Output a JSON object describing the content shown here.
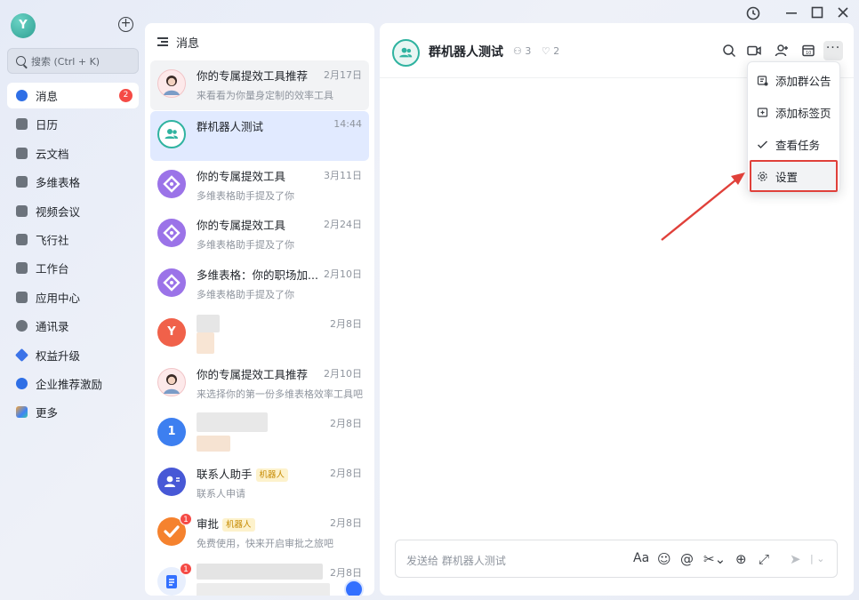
{
  "window": {
    "controls": [
      "history-icon",
      "minimize-icon",
      "maximize-icon",
      "close-icon"
    ]
  },
  "user": {
    "avatar_letter": "Y"
  },
  "search": {
    "placeholder": "搜索 (Ctrl + K)"
  },
  "nav": {
    "items": [
      {
        "label": "消息",
        "icon": "message-icon",
        "badge": "2",
        "active": true
      },
      {
        "label": "日历",
        "icon": "calendar-icon"
      },
      {
        "label": "云文档",
        "icon": "cloud-doc-icon"
      },
      {
        "label": "多维表格",
        "icon": "base-table-icon"
      },
      {
        "label": "视频会议",
        "icon": "video-meeting-icon"
      },
      {
        "label": "飞行社",
        "icon": "flight-club-icon"
      },
      {
        "label": "工作台",
        "icon": "workplace-icon"
      },
      {
        "label": "应用中心",
        "icon": "app-center-icon"
      },
      {
        "label": "通讯录",
        "icon": "contacts-icon"
      },
      {
        "label": "权益升级",
        "icon": "upgrade-diamond-icon"
      },
      {
        "label": "企业推荐激励",
        "icon": "referral-icon"
      },
      {
        "label": "更多",
        "icon": "more-apps-icon"
      }
    ]
  },
  "conversations": {
    "title": "消息",
    "items": [
      {
        "name": "你的专属提效工具推荐",
        "time": "2月17日",
        "preview": "来看看为你量身定制的效率工具",
        "avatar": "person-photo"
      },
      {
        "name": "群机器人测试",
        "time": "14:44",
        "preview": "",
        "avatar": "group-icon"
      },
      {
        "name": "你的专属提效工具",
        "time": "3月11日",
        "preview": "多维表格助手提及了你",
        "avatar": "base-logo"
      },
      {
        "name": "你的专属提效工具",
        "time": "2月24日",
        "preview": "多维表格助手提及了你",
        "avatar": "base-logo"
      },
      {
        "name": "多维表格：你的职场加...",
        "time": "2月10日",
        "preview": "多维表格助手提及了你",
        "avatar": "base-logo"
      },
      {
        "name": "",
        "time": "2月8日",
        "preview": "",
        "avatar_letter": "Y"
      },
      {
        "name": "你的专属提效工具推荐",
        "time": "2月10日",
        "preview": "来选择你的第一份多维表格效率工具吧",
        "avatar": "person-photo"
      },
      {
        "name": "",
        "time": "2月8日",
        "preview": "",
        "avatar_letter": "1"
      },
      {
        "name": "联系人助手",
        "tag": "机器人",
        "time": "2月8日",
        "preview": "联系人申请",
        "avatar": "contact-assistant-icon"
      },
      {
        "name": "审批",
        "tag": "机器人",
        "time": "2月8日",
        "preview": "免费使用，快来开启审批之旅吧",
        "avatar": "approval-icon",
        "badge": "1"
      },
      {
        "name": "",
        "time": "2月8日",
        "preview": "",
        "avatar": "doc-icon",
        "badge": "1"
      }
    ]
  },
  "chat": {
    "title": "群机器人测试",
    "members": "3",
    "bots": "2",
    "input_placeholder": "发送给 群机器人测试",
    "font_btn": "Aa"
  },
  "menu": {
    "items": [
      {
        "label": "添加群公告",
        "icon": "announcement-icon"
      },
      {
        "label": "添加标签页",
        "icon": "add-tab-icon"
      },
      {
        "label": "查看任务",
        "icon": "task-check-icon"
      },
      {
        "label": "设置",
        "icon": "gear-icon",
        "highlighted": true
      }
    ]
  },
  "colors": {
    "accent": "#3370ff",
    "badge": "#f54a45",
    "annotation": "#e0403a",
    "selected": "#e1eaff"
  }
}
